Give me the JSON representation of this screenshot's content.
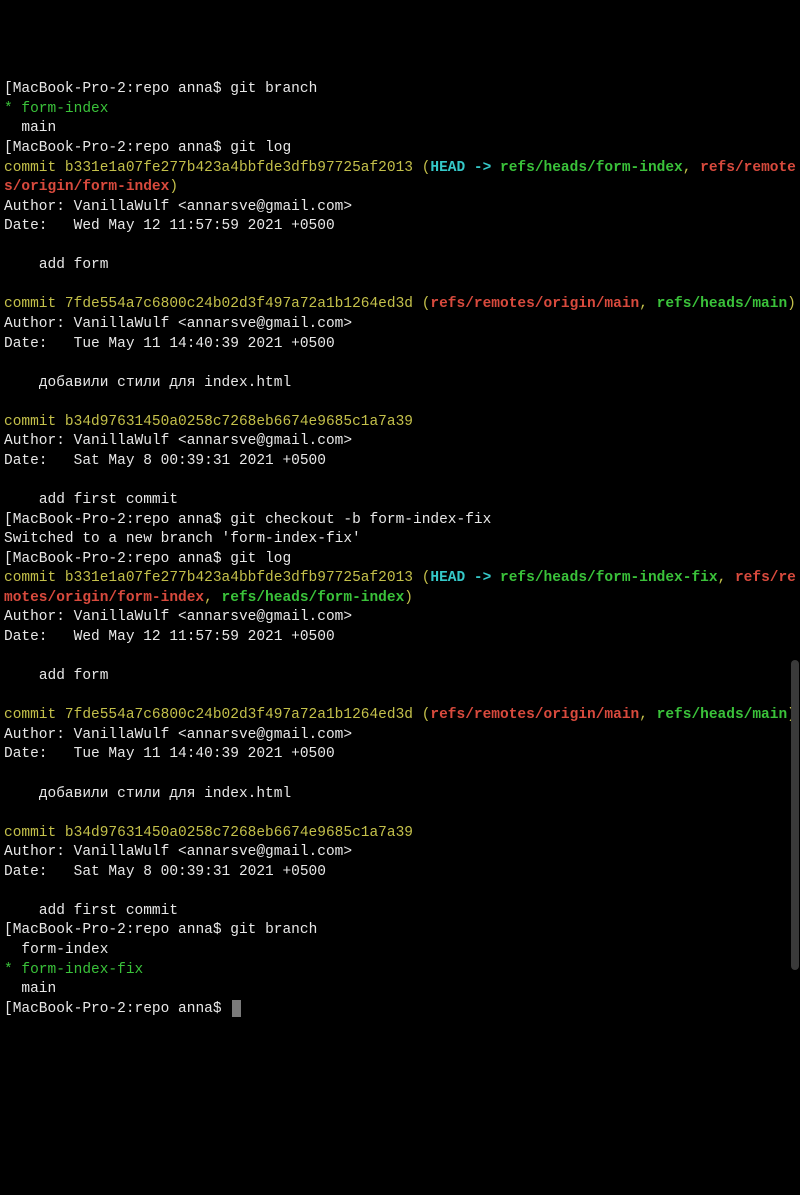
{
  "prompt": {
    "host": "MacBook-Pro-2:repo",
    "user": "anna$",
    "lb": "[",
    "rb": " "
  },
  "cmd": {
    "branch": "git branch",
    "log": "git log",
    "checkout": "git checkout -b form-index-fix"
  },
  "branches1": {
    "current_marker": "*",
    "current": "form-index",
    "other1": "main"
  },
  "log1": {
    "c1": {
      "label": "commit",
      "hash": "b331e1a07fe277b423a4bbfde3dfb97725af2013",
      "po": "(",
      "head": "HEAD -> ",
      "ref1": "refs/heads/form-index",
      "comma": ", ",
      "ref2": "refs/remotes/origin/form-index",
      "pc": ")",
      "author": "Author: VanillaWulf <annarsve@gmail.com>",
      "date": "Date:   Wed May 12 11:57:59 2021 +0500",
      "msg": "    add form"
    },
    "c2": {
      "label": "commit",
      "hash": "7fde554a7c6800c24b02d3f497a72a1b1264ed3d",
      "po": "(",
      "ref1": "refs/remotes/origin/main",
      "comma": ", ",
      "ref2": "refs/heads/main",
      "pc": ")",
      "author": "Author: VanillaWulf <annarsve@gmail.com>",
      "date": "Date:   Tue May 11 14:40:39 2021 +0500",
      "msg": "    добавили стили для index.html"
    },
    "c3": {
      "label": "commit",
      "hash": "b34d97631450a0258c7268eb6674e9685c1a7a39",
      "author": "Author: VanillaWulf <annarsve@gmail.com>",
      "date": "Date:   Sat May 8 00:39:31 2021 +0500",
      "msg": "    add first commit"
    }
  },
  "switched": "Switched to a new branch 'form-index-fix'",
  "log2": {
    "c1": {
      "label": "commit",
      "hash": "b331e1a07fe277b423a4bbfde3dfb97725af2013",
      "po": "(",
      "head": "HEAD -> ",
      "ref1": "refs/heads/form-index-fix",
      "comma1": ", ",
      "ref2": "refs/remotes/origin/form-index",
      "comma2": ", ",
      "ref3": "refs/heads/form-index",
      "pc": ")",
      "author": "Author: VanillaWulf <annarsve@gmail.com>",
      "date": "Date:   Wed May 12 11:57:59 2021 +0500",
      "msg": "    add form"
    },
    "c2": {
      "label": "commit",
      "hash": "7fde554a7c6800c24b02d3f497a72a1b1264ed3d",
      "po": "(",
      "ref1": "refs/remotes/origin/main",
      "comma": ", ",
      "ref2": "refs/heads/main",
      "pc": ")",
      "author": "Author: VanillaWulf <annarsve@gmail.com>",
      "date": "Date:   Tue May 11 14:40:39 2021 +0500",
      "msg": "    добавили стили для index.html"
    },
    "c3": {
      "label": "commit",
      "hash": "b34d97631450a0258c7268eb6674e9685c1a7a39",
      "author": "Author: VanillaWulf <annarsve@gmail.com>",
      "date": "Date:   Sat May 8 00:39:31 2021 +0500",
      "msg": "    add first commit"
    }
  },
  "branches2": {
    "other1": "form-index",
    "current_marker": "*",
    "current": "form-index-fix",
    "other2": "main"
  }
}
